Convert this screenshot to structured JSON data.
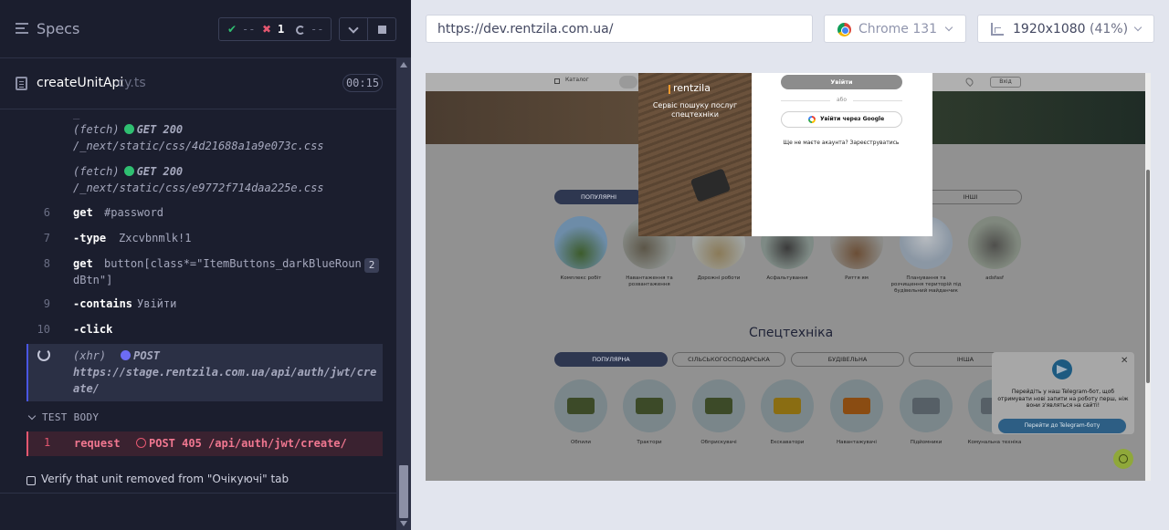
{
  "sidebar": {
    "title": "Specs"
  },
  "stats": {
    "passed_icon": "✔",
    "passed": "--",
    "failed_icon": "✖",
    "failed": "1",
    "pending": "--"
  },
  "spec": {
    "name": "createUnitApi",
    "ext": ".cy.ts",
    "duration": "00:15"
  },
  "commands": [
    {
      "type": "fetch",
      "label": "(fetch)",
      "method": "GET 200",
      "url": "/_next/static/css/4d21688a1a9e073c.css"
    },
    {
      "type": "fetch",
      "label": "(fetch)",
      "method": "GET 200",
      "url": "/_next/static/css/e9772f714daa225e.css"
    },
    {
      "num": "6",
      "name": "get",
      "message": "#password"
    },
    {
      "num": "7",
      "name": "-type",
      "message": "Zxcvbnmlk!1"
    },
    {
      "num": "8",
      "name": "get",
      "message": "button[class*=\"ItemButtons_darkBlueRoun",
      "message2": "dBtn\"]",
      "badge": "2"
    },
    {
      "num": "9",
      "name": "-contains",
      "message": "Увійти"
    },
    {
      "num": "10",
      "name": "-click",
      "message": ""
    },
    {
      "type": "xhr",
      "label": "(xhr)",
      "method": "POST",
      "url1": "https://stage.rentzila.com.ua/api/auth/jwt/cre",
      "url2": "ate/"
    }
  ],
  "test_body": {
    "header": "TEST BODY",
    "request": {
      "num": "1",
      "name": "request",
      "message": "POST 405 /api/auth/jwt/create/"
    }
  },
  "next_test": "Verify that unit removed from \"Очікуючі\" tab",
  "aut_header": {
    "url": "https://dev.rentzila.com.ua/",
    "browser": "Chrome 131",
    "viewport": "1920x1080",
    "scale": "(41%)"
  },
  "site": {
    "nav": {
      "catalog": "Каталог",
      "login": "Вхід"
    },
    "service_tabs": [
      {
        "label": "ПОПУЛЯРНІ",
        "active": true
      },
      {
        "label": "ІНШІ",
        "active": false
      }
    ],
    "services": [
      "Комплекс робіт",
      "Навантаження та розвантаження",
      "Дорожні роботи",
      "Асфальтування",
      "Риття ям",
      "Планування та розчищення територій під будівельний майданчик",
      "adsfasf"
    ],
    "spec_title": "Спецтехніка",
    "spec_tabs": [
      {
        "label": "ПОПУЛЯРНА",
        "active": true
      },
      {
        "label": "СІЛЬСЬКОГОСПОДАРСЬКА",
        "active": false
      },
      {
        "label": "БУДІВЕЛЬНА",
        "active": false
      },
      {
        "label": "ІНША",
        "active": false
      }
    ],
    "machines": [
      "Обпили",
      "Трактори",
      "Обприскувачі",
      "Екскаватори",
      "Навантажувачі",
      "Підйомники",
      "Комунальна техніка"
    ],
    "telegram": {
      "text": "Перейдіть у наш Telegram-бот, щоб отримувати нові запити на роботу перш, ніж вони з'являться на сайті!",
      "button": "Перейти до Telegram-боту",
      "close": "✕"
    },
    "modal": {
      "logo": "rentzila",
      "slogan": "Сервіс пошуку послуг спецтехніки",
      "login_button": "Увійти",
      "or": "або",
      "google_button": "Увійти через Google",
      "register_text": "Ще не маєте акаунта? Зареєструватись"
    }
  },
  "colors": {
    "pass": "#2fbf71",
    "fail": "#e45770",
    "accent": "#4956e3"
  }
}
